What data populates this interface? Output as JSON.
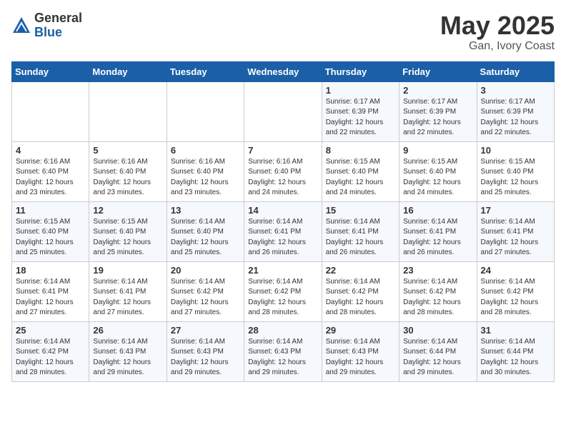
{
  "header": {
    "logo_general": "General",
    "logo_blue": "Blue",
    "month_title": "May 2025",
    "location": "Gan, Ivory Coast"
  },
  "days_of_week": [
    "Sunday",
    "Monday",
    "Tuesday",
    "Wednesday",
    "Thursday",
    "Friday",
    "Saturday"
  ],
  "weeks": [
    [
      {
        "day": "",
        "info": ""
      },
      {
        "day": "",
        "info": ""
      },
      {
        "day": "",
        "info": ""
      },
      {
        "day": "",
        "info": ""
      },
      {
        "day": "1",
        "info": "Sunrise: 6:17 AM\nSunset: 6:39 PM\nDaylight: 12 hours\nand 22 minutes."
      },
      {
        "day": "2",
        "info": "Sunrise: 6:17 AM\nSunset: 6:39 PM\nDaylight: 12 hours\nand 22 minutes."
      },
      {
        "day": "3",
        "info": "Sunrise: 6:17 AM\nSunset: 6:39 PM\nDaylight: 12 hours\nand 22 minutes."
      }
    ],
    [
      {
        "day": "4",
        "info": "Sunrise: 6:16 AM\nSunset: 6:40 PM\nDaylight: 12 hours\nand 23 minutes."
      },
      {
        "day": "5",
        "info": "Sunrise: 6:16 AM\nSunset: 6:40 PM\nDaylight: 12 hours\nand 23 minutes."
      },
      {
        "day": "6",
        "info": "Sunrise: 6:16 AM\nSunset: 6:40 PM\nDaylight: 12 hours\nand 23 minutes."
      },
      {
        "day": "7",
        "info": "Sunrise: 6:16 AM\nSunset: 6:40 PM\nDaylight: 12 hours\nand 24 minutes."
      },
      {
        "day": "8",
        "info": "Sunrise: 6:15 AM\nSunset: 6:40 PM\nDaylight: 12 hours\nand 24 minutes."
      },
      {
        "day": "9",
        "info": "Sunrise: 6:15 AM\nSunset: 6:40 PM\nDaylight: 12 hours\nand 24 minutes."
      },
      {
        "day": "10",
        "info": "Sunrise: 6:15 AM\nSunset: 6:40 PM\nDaylight: 12 hours\nand 25 minutes."
      }
    ],
    [
      {
        "day": "11",
        "info": "Sunrise: 6:15 AM\nSunset: 6:40 PM\nDaylight: 12 hours\nand 25 minutes."
      },
      {
        "day": "12",
        "info": "Sunrise: 6:15 AM\nSunset: 6:40 PM\nDaylight: 12 hours\nand 25 minutes."
      },
      {
        "day": "13",
        "info": "Sunrise: 6:14 AM\nSunset: 6:40 PM\nDaylight: 12 hours\nand 25 minutes."
      },
      {
        "day": "14",
        "info": "Sunrise: 6:14 AM\nSunset: 6:41 PM\nDaylight: 12 hours\nand 26 minutes."
      },
      {
        "day": "15",
        "info": "Sunrise: 6:14 AM\nSunset: 6:41 PM\nDaylight: 12 hours\nand 26 minutes."
      },
      {
        "day": "16",
        "info": "Sunrise: 6:14 AM\nSunset: 6:41 PM\nDaylight: 12 hours\nand 26 minutes."
      },
      {
        "day": "17",
        "info": "Sunrise: 6:14 AM\nSunset: 6:41 PM\nDaylight: 12 hours\nand 27 minutes."
      }
    ],
    [
      {
        "day": "18",
        "info": "Sunrise: 6:14 AM\nSunset: 6:41 PM\nDaylight: 12 hours\nand 27 minutes."
      },
      {
        "day": "19",
        "info": "Sunrise: 6:14 AM\nSunset: 6:41 PM\nDaylight: 12 hours\nand 27 minutes."
      },
      {
        "day": "20",
        "info": "Sunrise: 6:14 AM\nSunset: 6:42 PM\nDaylight: 12 hours\nand 27 minutes."
      },
      {
        "day": "21",
        "info": "Sunrise: 6:14 AM\nSunset: 6:42 PM\nDaylight: 12 hours\nand 28 minutes."
      },
      {
        "day": "22",
        "info": "Sunrise: 6:14 AM\nSunset: 6:42 PM\nDaylight: 12 hours\nand 28 minutes."
      },
      {
        "day": "23",
        "info": "Sunrise: 6:14 AM\nSunset: 6:42 PM\nDaylight: 12 hours\nand 28 minutes."
      },
      {
        "day": "24",
        "info": "Sunrise: 6:14 AM\nSunset: 6:42 PM\nDaylight: 12 hours\nand 28 minutes."
      }
    ],
    [
      {
        "day": "25",
        "info": "Sunrise: 6:14 AM\nSunset: 6:42 PM\nDaylight: 12 hours\nand 28 minutes."
      },
      {
        "day": "26",
        "info": "Sunrise: 6:14 AM\nSunset: 6:43 PM\nDaylight: 12 hours\nand 29 minutes."
      },
      {
        "day": "27",
        "info": "Sunrise: 6:14 AM\nSunset: 6:43 PM\nDaylight: 12 hours\nand 29 minutes."
      },
      {
        "day": "28",
        "info": "Sunrise: 6:14 AM\nSunset: 6:43 PM\nDaylight: 12 hours\nand 29 minutes."
      },
      {
        "day": "29",
        "info": "Sunrise: 6:14 AM\nSunset: 6:43 PM\nDaylight: 12 hours\nand 29 minutes."
      },
      {
        "day": "30",
        "info": "Sunrise: 6:14 AM\nSunset: 6:44 PM\nDaylight: 12 hours\nand 29 minutes."
      },
      {
        "day": "31",
        "info": "Sunrise: 6:14 AM\nSunset: 6:44 PM\nDaylight: 12 hours\nand 30 minutes."
      }
    ]
  ]
}
